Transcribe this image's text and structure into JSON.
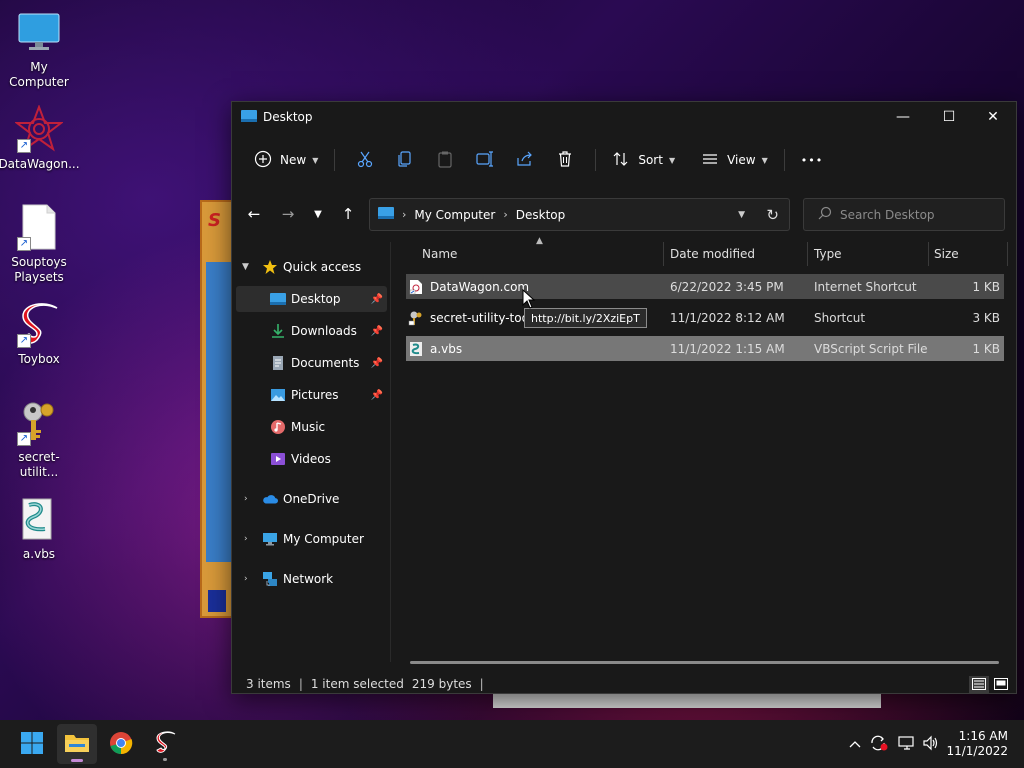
{
  "desktop": {
    "icons": [
      {
        "label": "My Computer",
        "icon": "monitor-icon"
      },
      {
        "label": "DataWagon...",
        "icon": "datawagon-icon"
      },
      {
        "label": "Souptoys Playsets",
        "icon": "blank-file-icon"
      },
      {
        "label": "Toybox",
        "icon": "toybox-icon"
      },
      {
        "label": "secret-utilit...",
        "icon": "keys-icon"
      },
      {
        "label": "a.vbs",
        "icon": "vbs-script-icon"
      }
    ]
  },
  "explorer": {
    "title": "Desktop",
    "controls": {
      "minimize": "—",
      "maximize": "☐",
      "close": "✕"
    },
    "commandbar": {
      "new_label": "New",
      "sort_label": "Sort",
      "view_label": "View",
      "more_label": "•••"
    },
    "address": {
      "crumbs": [
        "My Computer",
        "Desktop"
      ],
      "search_placeholder": "Search Desktop"
    },
    "nav": {
      "quick_access": "Quick access",
      "items": [
        {
          "label": "Desktop",
          "icon": "desktop-icon",
          "pinned": true
        },
        {
          "label": "Downloads",
          "icon": "download-icon",
          "pinned": true
        },
        {
          "label": "Documents",
          "icon": "documents-icon",
          "pinned": true
        },
        {
          "label": "Pictures",
          "icon": "pictures-icon",
          "pinned": true
        },
        {
          "label": "Music",
          "icon": "music-icon",
          "pinned": false
        },
        {
          "label": "Videos",
          "icon": "videos-icon",
          "pinned": false
        }
      ],
      "roots": [
        {
          "label": "OneDrive",
          "icon": "onedrive-icon"
        },
        {
          "label": "My Computer",
          "icon": "computer-icon"
        },
        {
          "label": "Network",
          "icon": "network-icon"
        }
      ]
    },
    "columns": {
      "name": "Name",
      "date": "Date modified",
      "type": "Type",
      "size": "Size"
    },
    "files": [
      {
        "name": "DataWagon.com",
        "date": "6/22/2022 3:45 PM",
        "type": "Internet Shortcut",
        "size": "1 KB",
        "state": "hover"
      },
      {
        "name": "secret-utility-tool",
        "date": "11/1/2022 8:12 AM",
        "type": "Shortcut",
        "size": "3 KB",
        "state": "normal"
      },
      {
        "name": "a.vbs",
        "date": "11/1/2022 1:15 AM",
        "type": "VBScript Script File",
        "size": "1 KB",
        "state": "selected"
      }
    ],
    "tooltip": "http://bit.ly/2XziEpT",
    "status": {
      "items": "3 items",
      "selection": "1 item selected",
      "bytes": "219 bytes"
    }
  },
  "taskbar": {
    "clock_time": "1:16 AM",
    "clock_date": "11/1/2022"
  }
}
